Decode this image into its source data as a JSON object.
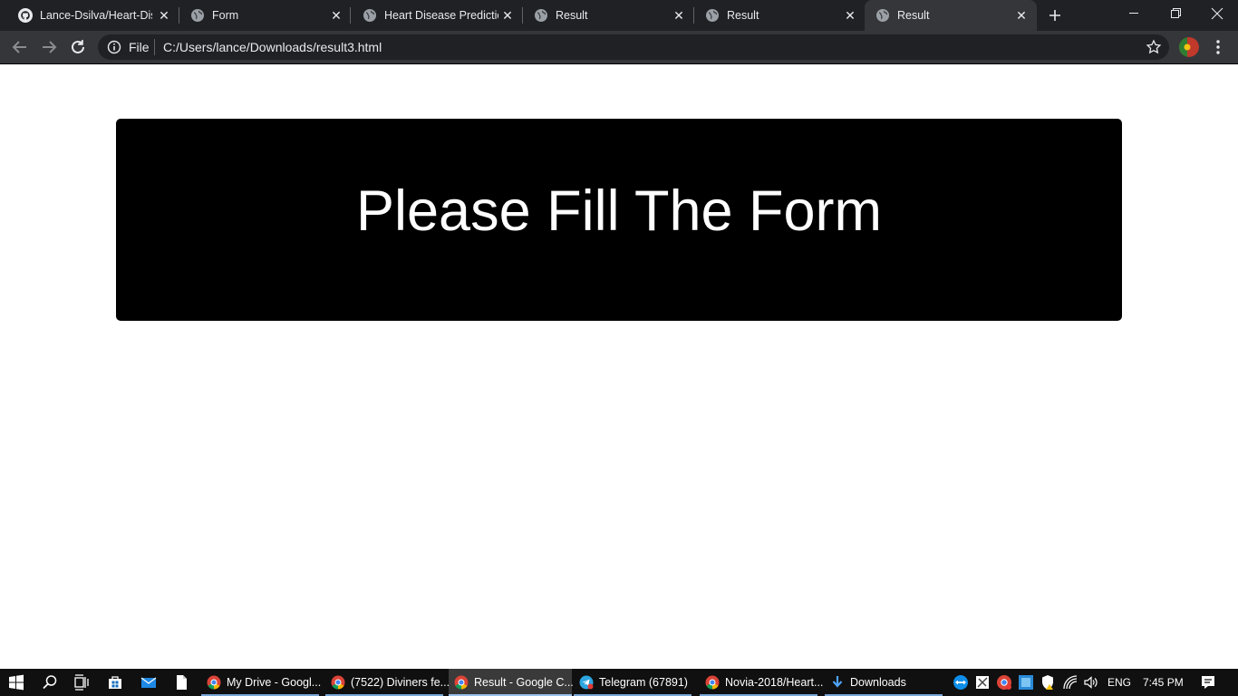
{
  "browser": {
    "tabs": [
      {
        "title": "Lance-Dsilva/Heart-Disease",
        "icon": "github-icon",
        "active": false
      },
      {
        "title": "Form",
        "icon": "globe-icon",
        "active": false
      },
      {
        "title": "Heart Disease Prediction",
        "icon": "globe-icon",
        "active": false
      },
      {
        "title": "Result",
        "icon": "globe-icon",
        "active": false
      },
      {
        "title": "Result",
        "icon": "globe-icon",
        "active": false
      },
      {
        "title": "Result",
        "icon": "globe-icon",
        "active": true
      }
    ],
    "new_tab_icon": "plus-icon",
    "window_controls": [
      "minimize-icon",
      "restore-icon",
      "close-icon"
    ],
    "address_bar": {
      "scheme_label": "File",
      "url": "C:/Users/lance/Downloads/result3.html"
    }
  },
  "page": {
    "message": "Please Fill The Form",
    "banner_color": "#000000",
    "text_color": "#ffffff"
  },
  "taskbar": {
    "pinned": [
      "windows-start-icon",
      "search-icon",
      "task-view-icon",
      "store-icon",
      "mail-icon",
      "file-icon"
    ],
    "apps": [
      {
        "label": "My Drive - Googl...",
        "icon": "chrome-icon",
        "active": false
      },
      {
        "label": "(7522) Diviners fe...",
        "icon": "chrome-icon",
        "active": false
      },
      {
        "label": "Result - Google C...",
        "icon": "chrome-icon",
        "active": true
      },
      {
        "label": "Telegram (67891)",
        "icon": "telegram-icon",
        "active": false
      },
      {
        "label": "Novia-2018/Heart...",
        "icon": "chrome-icon",
        "active": false
      },
      {
        "label": "Downloads",
        "icon": "download-arrow-icon",
        "active": false
      }
    ],
    "tray": {
      "language": "ENG",
      "time": "7:45 PM"
    }
  }
}
